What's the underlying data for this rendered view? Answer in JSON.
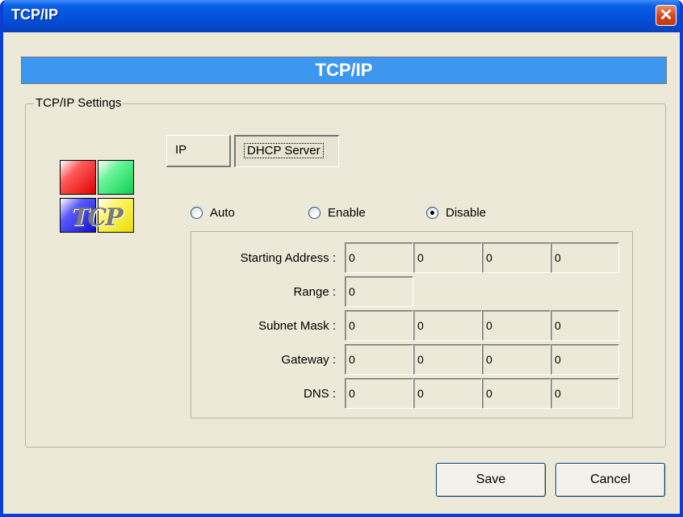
{
  "window": {
    "title": "TCP/IP",
    "close_glyph": "✕"
  },
  "banner": {
    "title": "TCP/IP"
  },
  "group": {
    "label": "TCP/IP Settings"
  },
  "logo": {
    "text": "TCP",
    "icon": "tcp-logo-icon"
  },
  "tabs": [
    {
      "label": "IP",
      "active": false
    },
    {
      "label": "DHCP Server",
      "active": true
    }
  ],
  "radios": [
    {
      "label": "Auto",
      "selected": false
    },
    {
      "label": "Enable",
      "selected": false
    },
    {
      "label": "Disable",
      "selected": true
    }
  ],
  "fields": {
    "starting_address": {
      "label": "Starting Address :",
      "values": [
        "0",
        "0",
        "0",
        "0"
      ]
    },
    "range": {
      "label": "Range :",
      "values": [
        "0"
      ]
    },
    "subnet_mask": {
      "label": "Subnet Mask :",
      "values": [
        "0",
        "0",
        "0",
        "0"
      ]
    },
    "gateway": {
      "label": "Gateway :",
      "values": [
        "0",
        "0",
        "0",
        "0"
      ]
    },
    "dns": {
      "label": "DNS :",
      "values": [
        "0",
        "0",
        "0",
        "0"
      ]
    }
  },
  "buttons": {
    "save": "Save",
    "cancel": "Cancel"
  },
  "colors": {
    "titlebar": "#0453dc",
    "banner": "#3d97f0",
    "face": "#ece9d8",
    "close": "#d5431e"
  }
}
